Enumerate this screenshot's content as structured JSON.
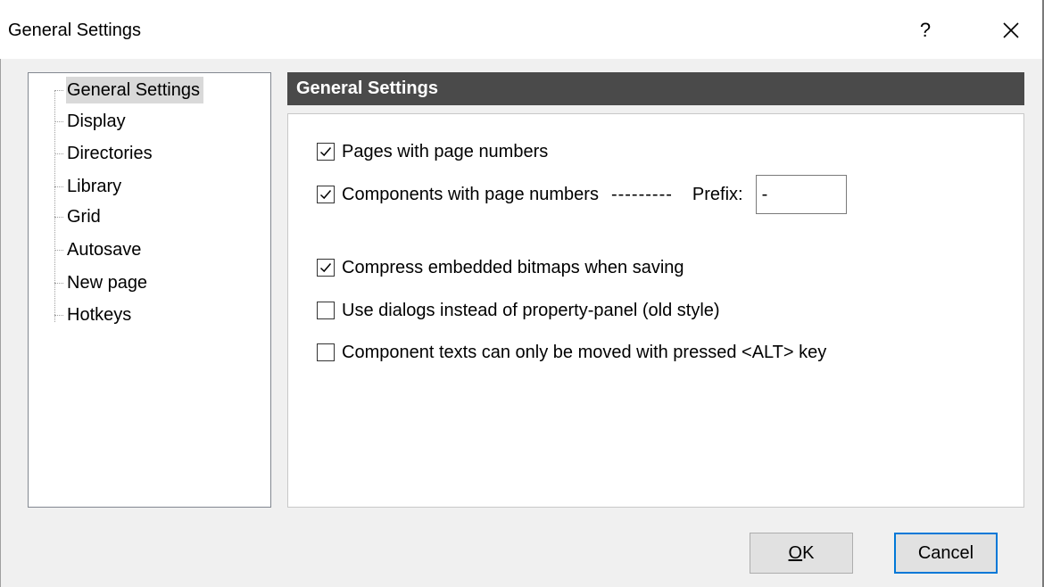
{
  "window": {
    "title": "General Settings",
    "help_label": "?",
    "close_label": "✕"
  },
  "tree": {
    "items": [
      {
        "label": "General Settings",
        "selected": true
      },
      {
        "label": "Display"
      },
      {
        "label": "Directories"
      },
      {
        "label": "Library"
      },
      {
        "label": "Grid"
      },
      {
        "label": "Autosave"
      },
      {
        "label": "New page"
      },
      {
        "label": "Hotkeys"
      }
    ]
  },
  "panel": {
    "header": "General Settings",
    "options": [
      {
        "label": "Pages with page numbers",
        "checked": true
      },
      {
        "label": "Components with page numbers",
        "checked": true,
        "dashes": "---------",
        "prefix_label": "Prefix:",
        "prefix_value": "-"
      },
      {
        "label": "Compress embedded bitmaps when saving",
        "checked": true
      },
      {
        "label": "Use dialogs instead of property-panel (old style)",
        "checked": false
      },
      {
        "label": "Component texts can only be moved with pressed <ALT> key",
        "checked": false
      }
    ]
  },
  "buttons": {
    "ok_mnemonic": "O",
    "ok_rest": "K",
    "cancel": "Cancel"
  }
}
